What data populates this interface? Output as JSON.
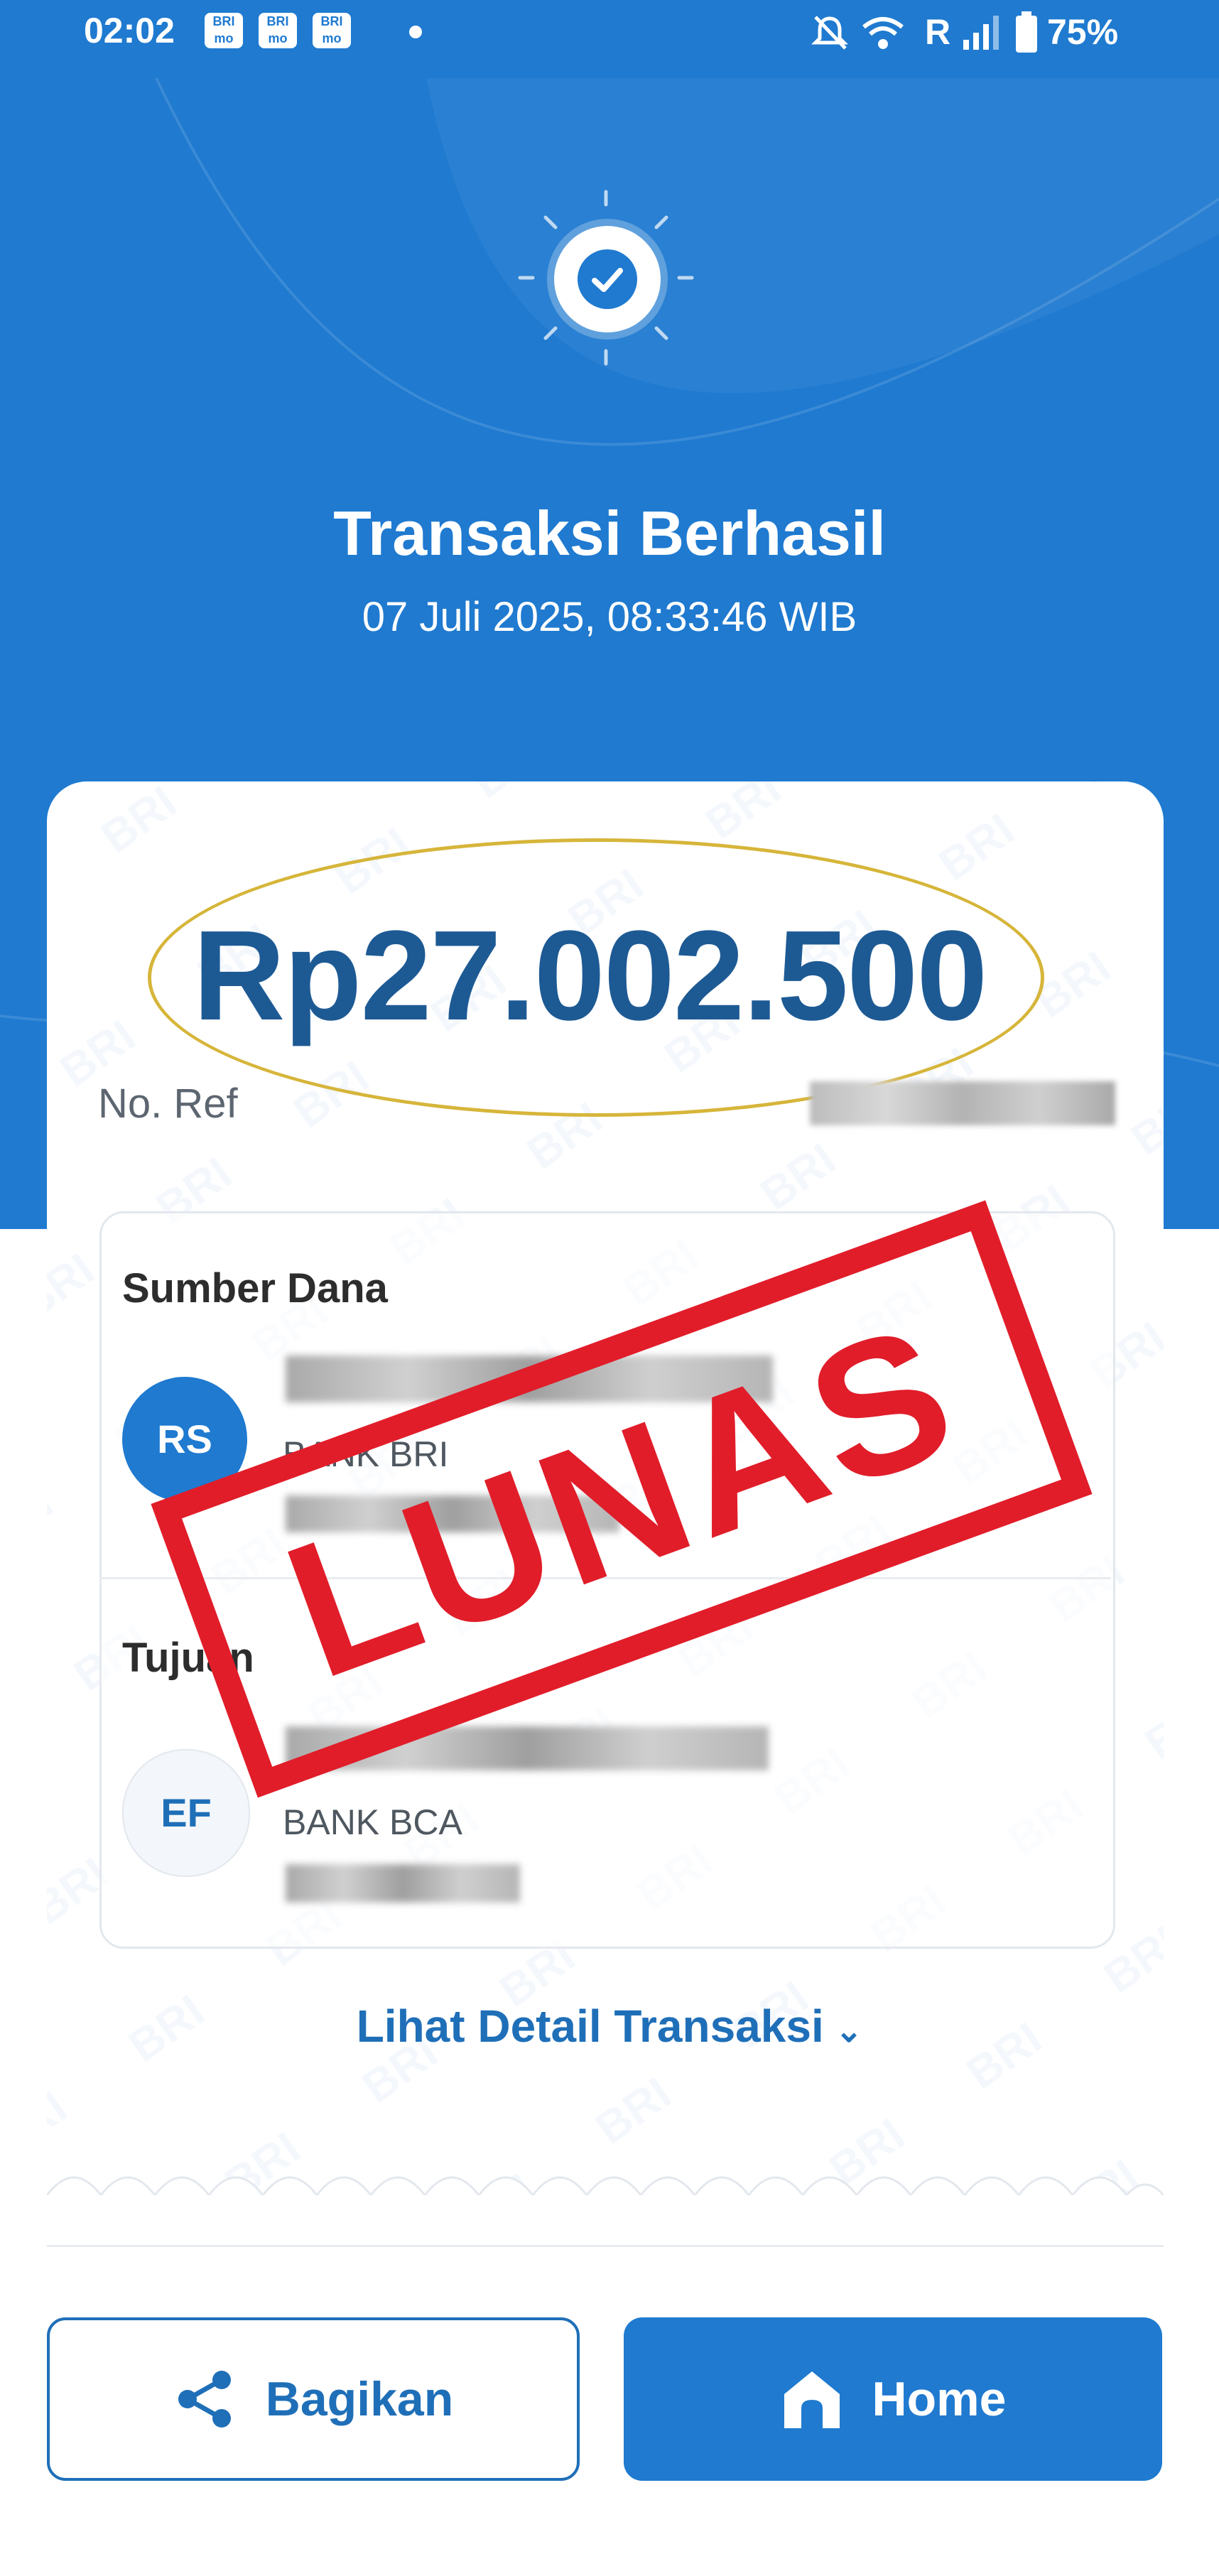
{
  "status_bar": {
    "time": "02:02",
    "apps": [
      "BRI mo",
      "BRI mo",
      "BRI mo"
    ],
    "network": "R",
    "battery": "75%"
  },
  "header": {
    "title": "Transaksi Berhasil",
    "datetime": "07 Juli 2025, 08:33:46 WIB"
  },
  "receipt": {
    "amount": "Rp27.002.500",
    "ref_label": "No. Ref",
    "source": {
      "section_title": "Sumber Dana",
      "initials": "RS",
      "bank": "BANK BRI"
    },
    "destination": {
      "section_title": "Tujuan",
      "initials": "EF",
      "bank": "BANK BCA"
    },
    "detail_link": "Lihat Detail Transaksi",
    "watermark_text": "BRI"
  },
  "stamp": {
    "text": "LUNAS",
    "color": "#e11d2a"
  },
  "actions": {
    "share_label": "Bagikan",
    "home_label": "Home"
  },
  "colors": {
    "primary": "#1f7ad0",
    "amount_text": "#1d5a94",
    "highlight_ring": "#d6b53a"
  }
}
